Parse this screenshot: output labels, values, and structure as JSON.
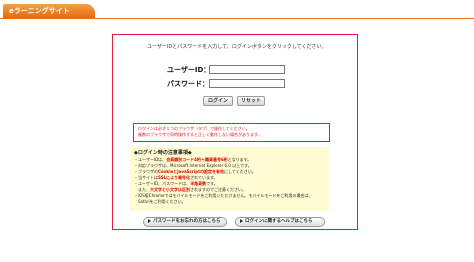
{
  "header": {
    "site_title": "eラーニングサイト"
  },
  "login": {
    "intro": "ユーザーIDとパスワードを入力して、ログインボタンをクリックしてください。",
    "user_id_label": "ユーザーID：",
    "password_label": "パスワード：",
    "user_id_value": "",
    "password_value": "",
    "login_button": "ログイン",
    "reset_button": "リセット"
  },
  "warning": {
    "line1": "ログインは必ず１つのブラウザ（タブ）で操作してください。",
    "line2": "複数のブラウザで同時操作すると正しく動作しない場合があります。"
  },
  "notes": {
    "title": "◆ログイン時の注意事項◆",
    "line1_prefix": "・ユーザーIDは、",
    "line1_red": "会員識別コード4桁＋職員番号6桁",
    "line1_suffix": "となります。",
    "line2": "・対応ブラウザは、Microsoft Internet Explorer 6.0 以上です。",
    "line3_prefix": "・ブラウザの",
    "line3_red": "CookieとJavaScriptの設定を有効",
    "line3_suffix": "にしてください。",
    "line4_prefix": "・当サイトは",
    "line4_red": "SSLにより暗号化",
    "line4_suffix": "されています。",
    "line5_prefix": "・ユーザーID、パスワードは、",
    "line5_red": "半角英数",
    "line5_suffix": "です。",
    "line6_prefix": "　また、",
    "line6_red": "大文字と小文字は区別",
    "line6_suffix": "されますのでご注意ください。",
    "line7": "・iOS版Chromeではモバイルモードをご利用いただけません。モバイルモードをご利用の場合は、",
    "line8": "　Safariをご利用ください。"
  },
  "links": {
    "forgot_password": "パスワードをお忘れの方はこちら",
    "login_help": "ログインに関するヘルプはこちら"
  }
}
